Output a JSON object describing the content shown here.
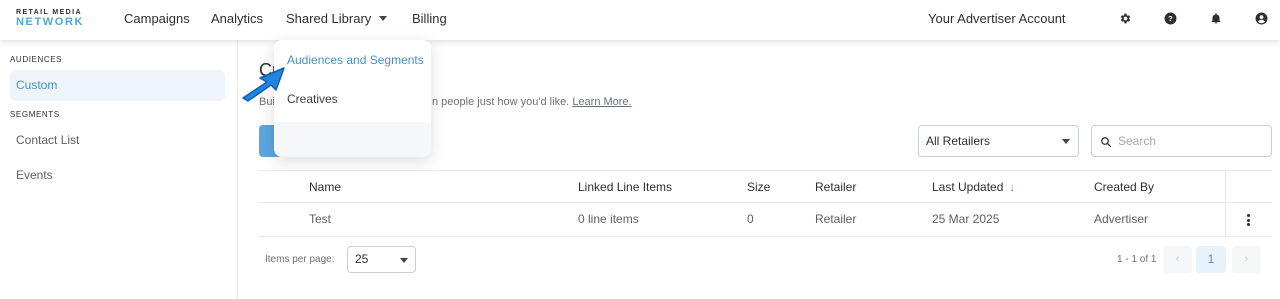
{
  "brand": {
    "line1": "RETAIL MEDIA",
    "line2": "NETWORK"
  },
  "nav": {
    "campaigns": "Campaigns",
    "analytics": "Analytics",
    "shared_library": "Shared Library",
    "billing": "Billing",
    "account": "Your Advertiser Account"
  },
  "icons": {
    "settings": "gear-icon",
    "help": "help-icon",
    "notifications": "bell-icon",
    "profile": "user-icon"
  },
  "sidebar": {
    "section1": "AUDIENCES",
    "custom": "Custom",
    "section2": "SEGMENTS",
    "contact_list": "Contact List",
    "events": "Events"
  },
  "main": {
    "title_fragment": "Cu",
    "desc_fragment": "Bui",
    "desc": "n people just how you'd like.",
    "learn_more": "Learn More."
  },
  "filters": {
    "retailer_select": "All Retailers",
    "search_placeholder": "Search"
  },
  "table": {
    "headers": [
      "Name",
      "Linked Line Items",
      "Size",
      "Retailer",
      "Last Updated",
      "Created By"
    ],
    "rows": [
      [
        "Test",
        "0 line items",
        "0",
        "Retailer",
        "25 Mar 2025",
        "Advertiser"
      ]
    ]
  },
  "pagination": {
    "items_per_page_label": "Items per page:",
    "items_per_page_value": "25",
    "range": "1 - 1 of 1",
    "prev": "‹",
    "current": "1",
    "next": "›"
  },
  "dropdown": {
    "item1": "Audiences and Segments",
    "item2": "Creatives"
  },
  "colors": {
    "accent": "#4a90c8",
    "primary_button": "#5aa6e0",
    "pointer": "#1f86e0"
  }
}
